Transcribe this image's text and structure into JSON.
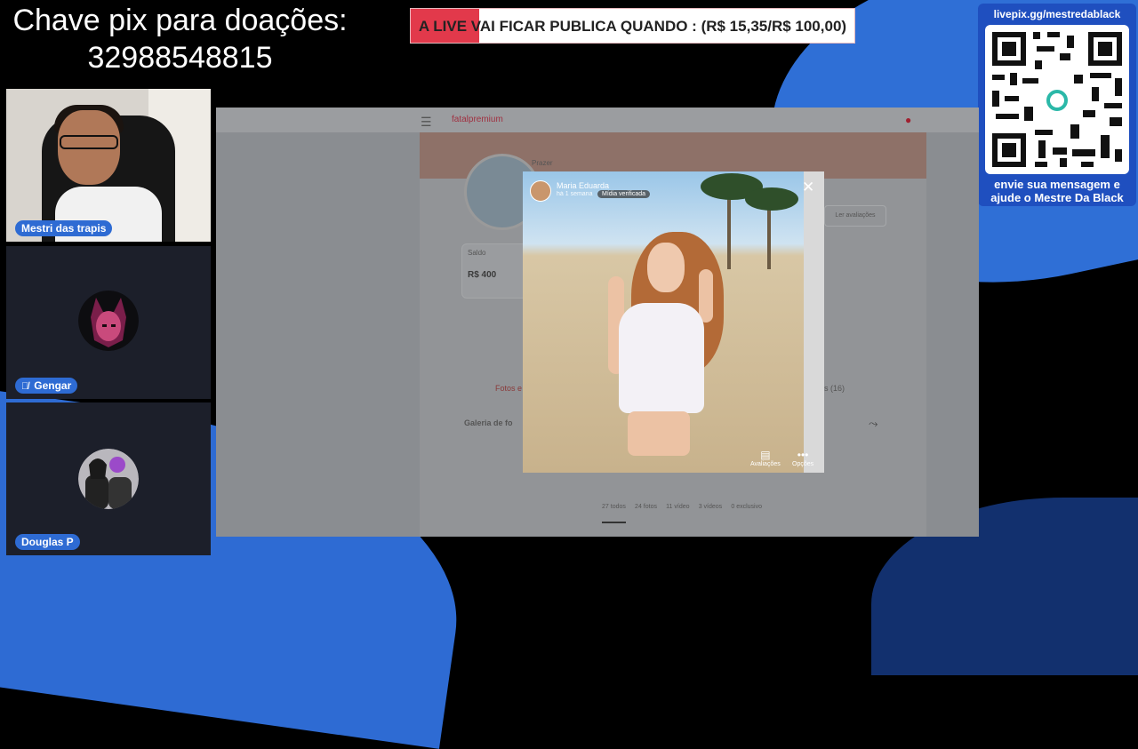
{
  "donation": {
    "line1": "Chave pix para doações:",
    "line2": "32988548815"
  },
  "banner": {
    "text": "A LIVE VAI FICAR PUBLICA QUANDO : (R$ 15,35/R$ 100,00)",
    "progress_fraction": 0.1535,
    "fill_color": "#e2394b"
  },
  "qr": {
    "url": "livepix.gg/mestredablack",
    "caption_line1": "envie sua mensagem e",
    "caption_line2": "ajude o Mestre Da Black"
  },
  "participants": [
    {
      "name": "Mestri das trapis",
      "muted": false
    },
    {
      "name": "Gengar",
      "muted": true
    },
    {
      "name": "Douglas P",
      "muted": false
    }
  ],
  "shared_page": {
    "logo": "fatalpremium",
    "profile_tag": "Prazer",
    "card_title": "Saldo",
    "price": "R$ 400",
    "reviews_button": "Ler avaliações",
    "tab_left": "Fotos e",
    "tab_right": "s (16)",
    "gallery_label": "Galeria de fo",
    "stats": [
      {
        "count": "27",
        "label": "todos"
      },
      {
        "count": "24",
        "label": "fotos"
      },
      {
        "count": "11",
        "label": "vídeo"
      },
      {
        "count": "3",
        "label": "vídeos"
      },
      {
        "count": "0",
        "label": "exclusivo"
      }
    ]
  },
  "modal": {
    "name": "Maria Eduarda",
    "subtitle": "há 1 semana",
    "badge": "Mídia verificada",
    "action_reviews": "Avaliações",
    "action_options": "Opções",
    "close_icon": "close-icon"
  }
}
